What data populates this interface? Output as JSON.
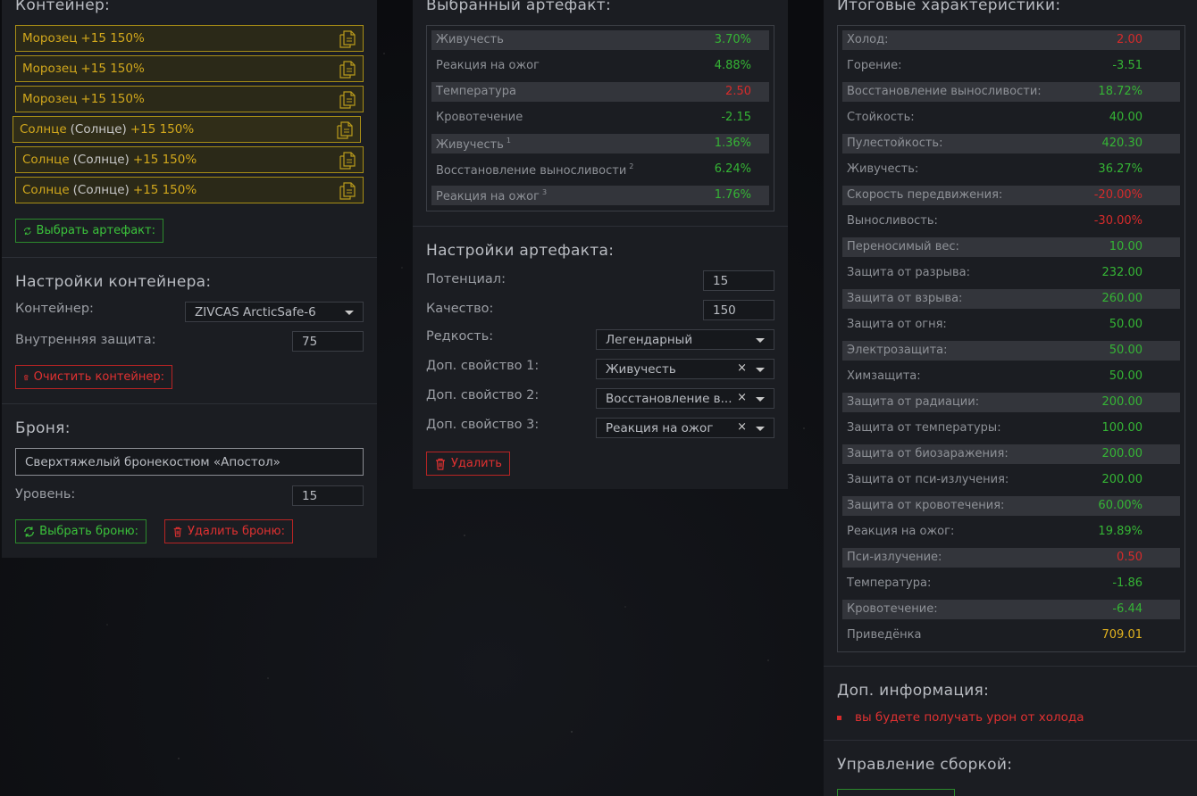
{
  "container": {
    "title": "Контейнер:",
    "slots": [
      {
        "name": "Морозец",
        "extra": "",
        "suffix": "+15 150%"
      },
      {
        "name": "Морозец",
        "extra": "",
        "suffix": "+15 150%"
      },
      {
        "name": "Морозец",
        "extra": "",
        "suffix": "+15 150%"
      },
      {
        "name": "Солнце",
        "extra": "(Солнце)",
        "suffix": "+15 150%"
      },
      {
        "name": "Солнце",
        "extra": "(Солнце)",
        "suffix": "+15 150%"
      },
      {
        "name": "Солнце",
        "extra": "(Солнце)",
        "suffix": "+15 150%"
      }
    ],
    "select_artifact_label": "Выбрать артефакт:"
  },
  "container_settings": {
    "title": "Настройки контейнера:",
    "container_label": "Контейнер:",
    "container_value": "ZIVCAS ArcticSafe-6",
    "inner_protection_label": "Внутренняя защита:",
    "inner_protection_value": "75",
    "clear_label": "Очистить контейнер:"
  },
  "armor": {
    "title": "Броня:",
    "name_value": "Сверхтяжелый бронекостюм «Апостол»",
    "level_label": "Уровень:",
    "level_value": "15",
    "select_label": "Выбрать броню:",
    "delete_label": "Удалить броню:"
  },
  "selected_artifact": {
    "title": "Выбранный артефакт:",
    "stats": [
      {
        "label": "Живучесть",
        "sup": "",
        "value": "3.70%",
        "neg": false
      },
      {
        "label": "Реакция на ожог",
        "sup": "",
        "value": "4.88%",
        "neg": false
      },
      {
        "label": "Температура",
        "sup": "",
        "value": "2.50",
        "neg": true
      },
      {
        "label": "Кровотечение",
        "sup": "",
        "value": "-2.15",
        "neg": false
      },
      {
        "label": "Живучесть",
        "sup": "1",
        "value": "1.36%",
        "neg": false
      },
      {
        "label": "Восстановление выносливости",
        "sup": "2",
        "value": "6.24%",
        "neg": false
      },
      {
        "label": "Реакция на ожог",
        "sup": "3",
        "value": "1.76%",
        "neg": false
      }
    ]
  },
  "artifact_settings": {
    "title": "Настройки артефакта:",
    "potential_label": "Потенциал:",
    "potential_value": "15",
    "quality_label": "Качество:",
    "quality_value": "150",
    "rarity_label": "Редкость:",
    "rarity_value": "Легендарный",
    "prop1_label": "Доп. свойство 1:",
    "prop1_value": "Живучесть",
    "prop2_label": "Доп. свойство 2:",
    "prop2_value": "Восстановление в...",
    "prop3_label": "Доп. свойство 3:",
    "prop3_value": "Реакция на ожог",
    "clear_x": "×",
    "delete_label": "Удалить"
  },
  "totals": {
    "title": "Итоговые характеристики:",
    "stats": [
      {
        "label": "Холод:",
        "value": "2.00",
        "tone": "neg"
      },
      {
        "label": "Горение:",
        "value": "-3.51",
        "tone": "pos"
      },
      {
        "label": "Восстановление выносливости:",
        "value": "18.72%",
        "tone": "pos"
      },
      {
        "label": "Стойкость:",
        "value": "40.00",
        "tone": "pos"
      },
      {
        "label": "Пулестойкость:",
        "value": "420.30",
        "tone": "pos"
      },
      {
        "label": "Живучесть:",
        "value": "36.27%",
        "tone": "pos"
      },
      {
        "label": "Скорость передвижения:",
        "value": "-20.00%",
        "tone": "neg"
      },
      {
        "label": "Выносливость:",
        "value": "-30.00%",
        "tone": "neg"
      },
      {
        "label": "Переносимый вес:",
        "value": "10.00",
        "tone": "pos"
      },
      {
        "label": "Защита от разрыва:",
        "value": "232.00",
        "tone": "pos"
      },
      {
        "label": "Защита от взрыва:",
        "value": "260.00",
        "tone": "pos"
      },
      {
        "label": "Защита от огня:",
        "value": "50.00",
        "tone": "pos"
      },
      {
        "label": "Электрозащита:",
        "value": "50.00",
        "tone": "pos"
      },
      {
        "label": "Химзащита:",
        "value": "50.00",
        "tone": "pos"
      },
      {
        "label": "Защита от радиации:",
        "value": "200.00",
        "tone": "pos"
      },
      {
        "label": "Защита от температуры:",
        "value": "100.00",
        "tone": "pos"
      },
      {
        "label": "Защита от биозаражения:",
        "value": "200.00",
        "tone": "pos"
      },
      {
        "label": "Защита от пси-излучения:",
        "value": "200.00",
        "tone": "pos"
      },
      {
        "label": "Защита от кровотечения:",
        "value": "60.00%",
        "tone": "pos"
      },
      {
        "label": "Реакция на ожог:",
        "value": "19.89%",
        "tone": "pos"
      },
      {
        "label": "Пси-излучение:",
        "value": "0.50",
        "tone": "neg"
      },
      {
        "label": "Температура:",
        "value": "-1.86",
        "tone": "pos"
      },
      {
        "label": "Кровотечение:",
        "value": "-6.44",
        "tone": "pos"
      },
      {
        "label": "Приведёнка",
        "value": "709.01",
        "tone": "gold"
      }
    ]
  },
  "extra_info": {
    "title": "Доп. информация:",
    "items": [
      "вы будете получать урон от холода"
    ]
  },
  "build_management": {
    "title": "Управление сборкой:"
  },
  "colors": {
    "panel": "#1b1d22",
    "positive": "#35b535",
    "negative": "#d62b2b",
    "gold": "#e2b21f",
    "slot_border": "#a88e16"
  }
}
